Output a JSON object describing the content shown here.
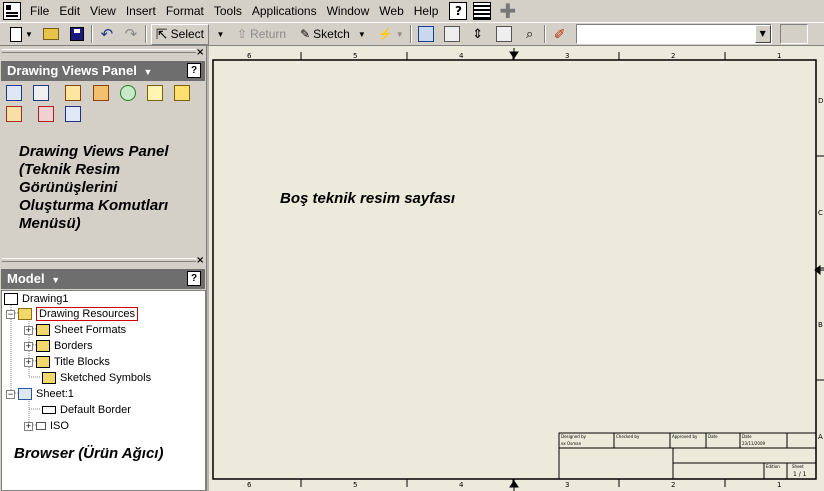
{
  "menu": {
    "items": [
      "File",
      "Edit",
      "View",
      "Insert",
      "Format",
      "Tools",
      "Applications",
      "Window",
      "Web",
      "Help"
    ]
  },
  "toolbar": {
    "select_label": "Select",
    "return_label": "Return",
    "sketch_label": "Sketch",
    "combo_value": ""
  },
  "drawing_views_panel": {
    "title": "Drawing Views Panel",
    "help": "?",
    "annotation": [
      "Drawing Views Panel",
      "(Teknik Resim",
      "Görünüşlerini",
      "Oluşturma Komutları",
      "Menüsü)"
    ]
  },
  "model_panel": {
    "title": "Model",
    "help": "?",
    "annotation": "Browser (Ürün Ağıcı)"
  },
  "tree": {
    "items": [
      {
        "label": "Drawing1",
        "icon": "drawing-icon"
      },
      {
        "label": "Drawing Resources",
        "icon": "folder-icon"
      },
      {
        "label": "Sheet Formats",
        "icon": "folder-icon"
      },
      {
        "label": "Borders",
        "icon": "folder-icon"
      },
      {
        "label": "Title Blocks",
        "icon": "folder-icon"
      },
      {
        "label": "Sketched Symbols",
        "icon": "folder-icon"
      },
      {
        "label": "Sheet:1",
        "icon": "sheet-icon"
      },
      {
        "label": "Default Border",
        "icon": "border-icon"
      },
      {
        "label": "ISO",
        "icon": "title-block-icon"
      }
    ]
  },
  "sheet": {
    "label": "Boş teknik resim sayfası",
    "background": "#eceadb",
    "top_zones": [
      "6",
      "5",
      "4",
      "3",
      "2",
      "1"
    ],
    "bottom_zones": [
      "6",
      "5",
      "4",
      "3",
      "2",
      "1"
    ],
    "right_zones": [
      "D",
      "C",
      "B",
      "A"
    ],
    "title_block": {
      "designed_by": "Designed by",
      "checked_by": "Checked by",
      "approved_by": "Approved by",
      "date": "Date",
      "date_label": "Date",
      "designer_name": "ex Osman",
      "date_value": "23/11/2009",
      "edition": "Edition",
      "sheet": "Sheet",
      "sheet_value": "1 / 1"
    }
  }
}
